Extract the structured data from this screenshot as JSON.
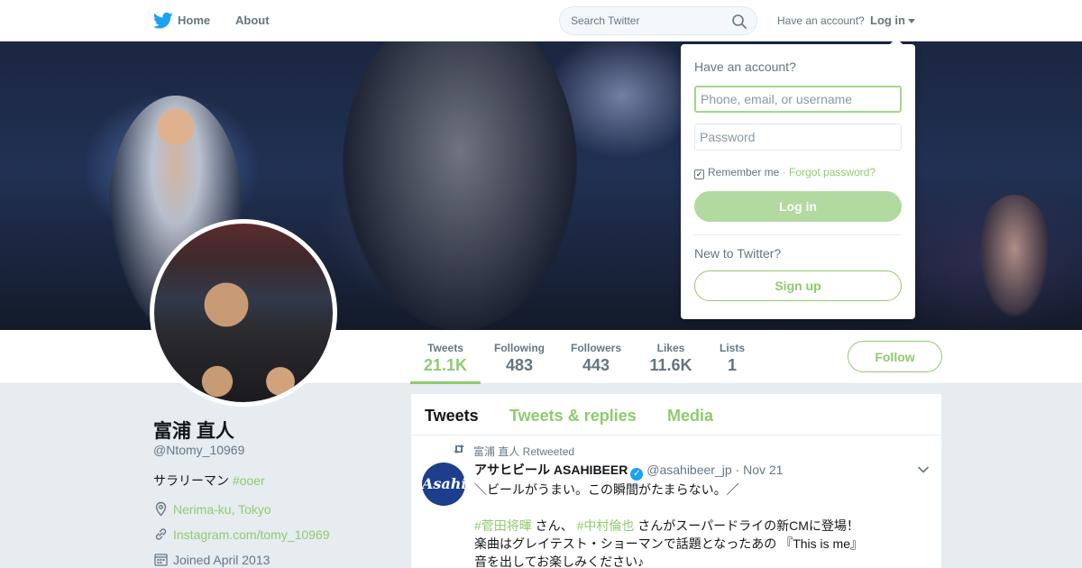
{
  "nav": {
    "home_label": "Home",
    "about_label": "About",
    "search_placeholder": "Search Twitter",
    "have_account_label": "Have an account?",
    "login_label": "Log in",
    "brand_icon": "twitter-bird-icon",
    "brand_color": "#1da1f2"
  },
  "profile": {
    "name": "富浦 直人",
    "handle": "@Ntomy_10969",
    "bio_text": "サラリーマン ",
    "bio_hashtag": "#ooer",
    "location": "Nerima-ku, Tokyo",
    "website": "Instagram.com/tomy_10969",
    "joined": "Joined April 2013"
  },
  "stats": [
    {
      "label": "Tweets",
      "value": "21.1K",
      "active": true
    },
    {
      "label": "Following",
      "value": "483"
    },
    {
      "label": "Followers",
      "value": "443"
    },
    {
      "label": "Likes",
      "value": "11.6K"
    },
    {
      "label": "Lists",
      "value": "1"
    }
  ],
  "follow_label": "Follow",
  "accent_color": "#8fcb6f",
  "timeline": {
    "tabs": [
      "Tweets",
      "Tweets & replies",
      "Media"
    ],
    "tweet": {
      "retweeted_by": "富浦 直人 Retweeted",
      "avatar_text": "Asahi",
      "name": "アサヒビール ASAHIBEER",
      "handle": "@asahibeer_jp",
      "date": "· Nov 21",
      "line1": "＼ビールがうまい。この瞬間がたまらない。／",
      "line2_tag1": "#菅田将暉",
      "line2_mid": " さん、 ",
      "line2_tag2": "#中村倫也",
      "line2_rest": " さんがスーパードライの新CMに登場！",
      "line3": "楽曲はグレイテスト・ショーマンで話題となったあの 『This is me』",
      "line4": "音を出してお楽しみください♪"
    }
  },
  "login_dropdown": {
    "title": "Have an account?",
    "username_placeholder": "Phone, email, or username",
    "password_placeholder": "Password",
    "remember_label": "Remember me",
    "forgot_label": "· Forgot password?",
    "login_button": "Log in",
    "new_label": "New to Twitter?",
    "signup_button": "Sign up"
  }
}
